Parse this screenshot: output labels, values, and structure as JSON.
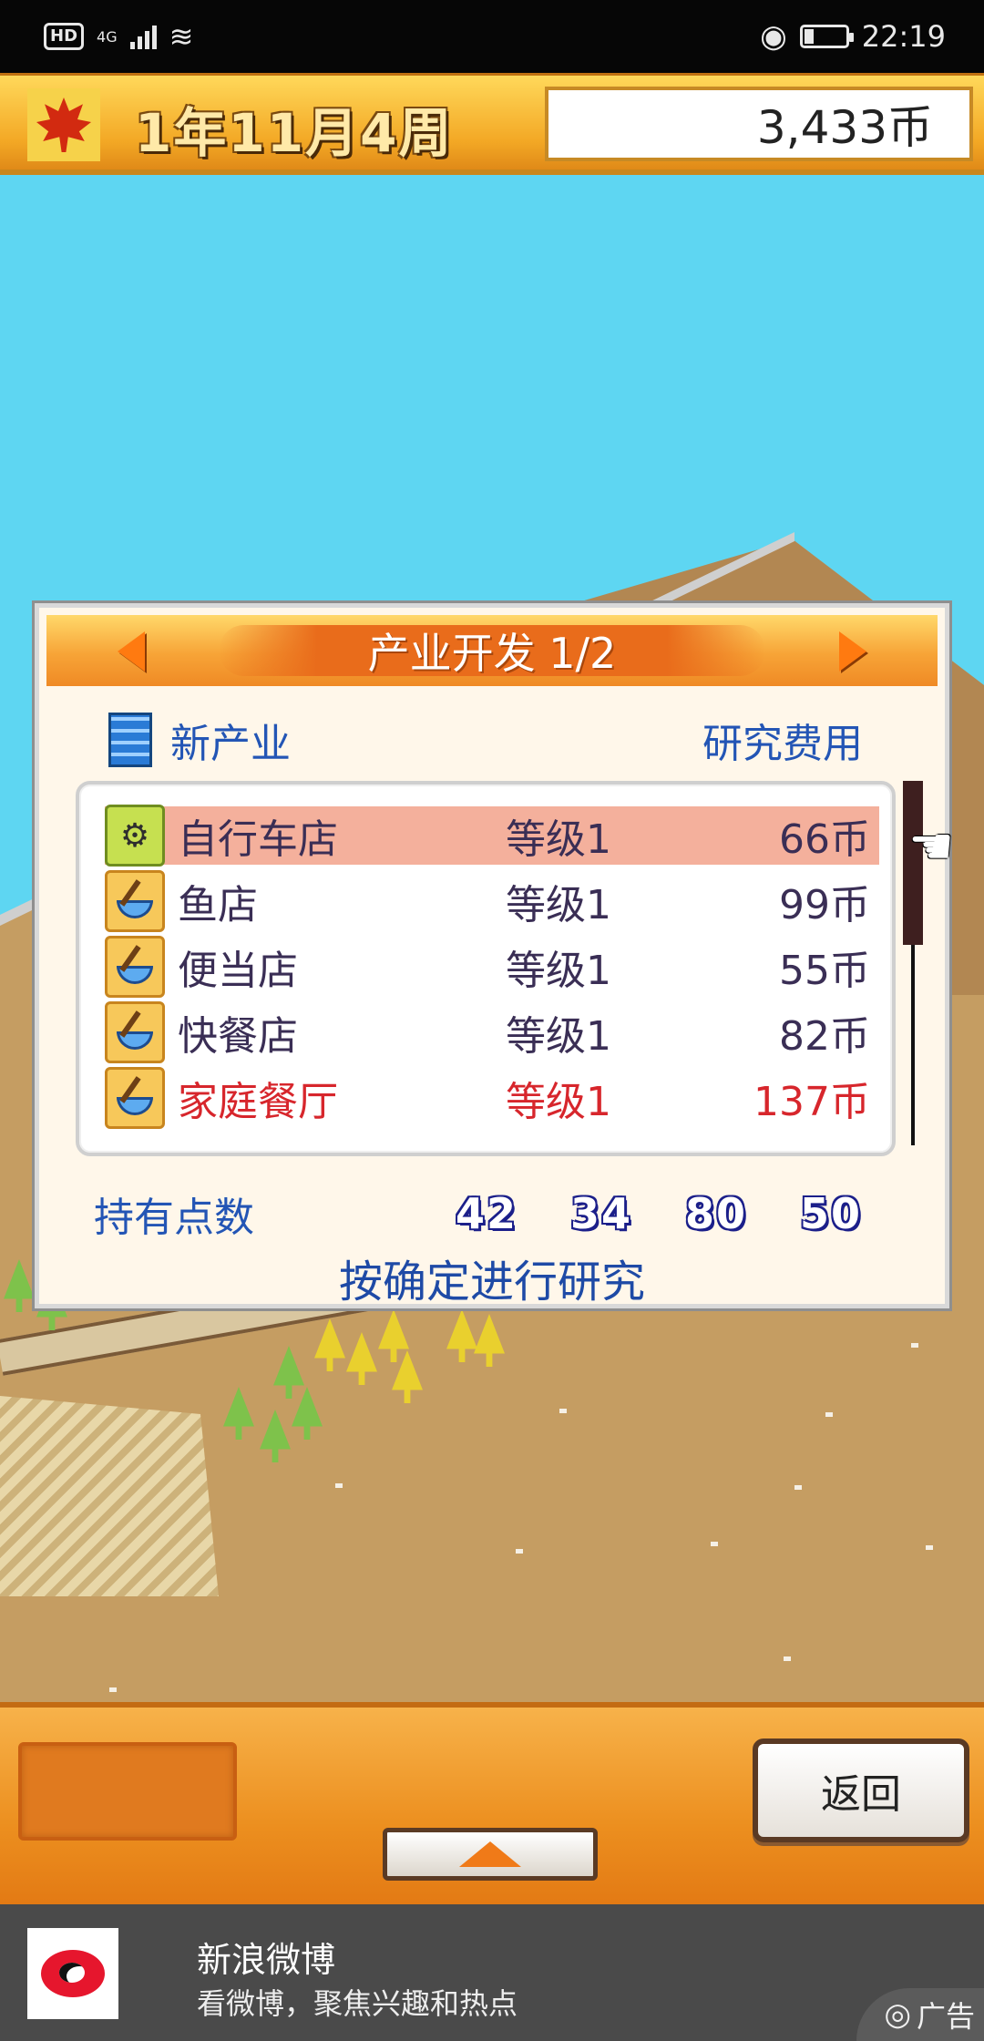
{
  "status_bar": {
    "hd": "HD",
    "network": "4G",
    "time": "22:19",
    "icons": [
      "hd-badge",
      "signal-icon",
      "wifi-icon",
      "eye-icon",
      "battery-icon"
    ]
  },
  "game_bar": {
    "date": "1年11月4周",
    "money": "3,433币",
    "season_icon": "maple-leaf-icon"
  },
  "dialog": {
    "title": "产业开发 1/2",
    "category_label": "新产业",
    "cost_header": "研究费用",
    "rows": [
      {
        "name": "自行车店",
        "level": "等级1",
        "cost": "66币",
        "icon": "bicycle-icon",
        "selected": true,
        "locked": false
      },
      {
        "name": "鱼店",
        "level": "等级1",
        "cost": "99币",
        "icon": "bowl-icon",
        "selected": false,
        "locked": false
      },
      {
        "name": "便当店",
        "level": "等级1",
        "cost": "55币",
        "icon": "bowl-icon",
        "selected": false,
        "locked": false
      },
      {
        "name": "快餐店",
        "level": "等级1",
        "cost": "82币",
        "icon": "bowl-icon",
        "selected": false,
        "locked": false
      },
      {
        "name": "家庭餐厅",
        "level": "等级1",
        "cost": "137币",
        "icon": "bowl-icon",
        "selected": false,
        "locked": true
      }
    ],
    "points_label": "持有点数",
    "points": [
      "42",
      "34",
      "80",
      "50"
    ],
    "hint": "按确定进行研究",
    "colors": {
      "locked_text": "#d7262c",
      "label_blue": "#2355b5",
      "selected_row": "#f4b09c"
    }
  },
  "bottom": {
    "back_label": "返回"
  },
  "ad": {
    "title": "新浪微博",
    "subtitle": "看微博，聚焦兴趣和热点",
    "tag": "广告",
    "logo": "weibo-logo"
  }
}
